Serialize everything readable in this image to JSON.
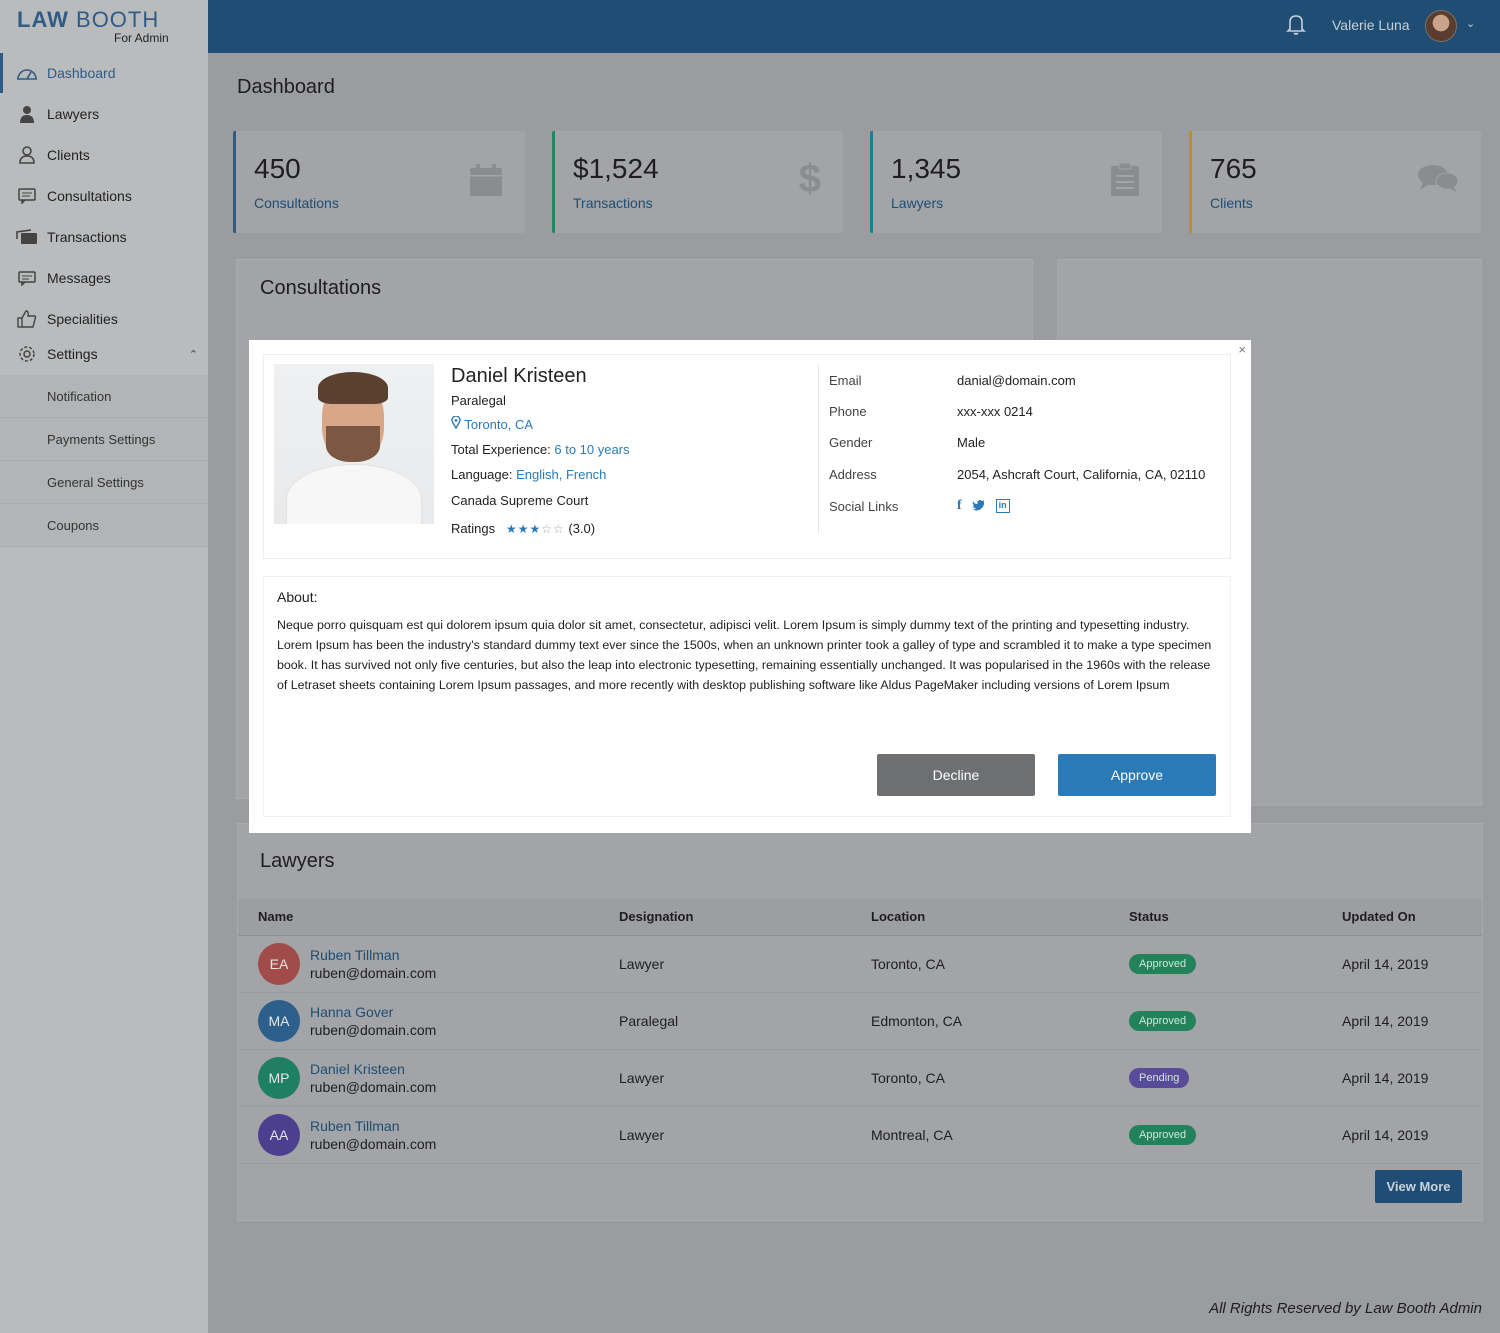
{
  "brand": {
    "name_bold": "LAW",
    "name_light": "BOOTH",
    "subtitle": "For Admin"
  },
  "sidebar": {
    "items": [
      {
        "label": "Dashboard",
        "icon": "dashboard-gauge-icon",
        "active": true
      },
      {
        "label": "Lawyers",
        "icon": "lawyer-icon"
      },
      {
        "label": "Clients",
        "icon": "clients-icon"
      },
      {
        "label": "Consultations",
        "icon": "consultations-icon"
      },
      {
        "label": "Transactions",
        "icon": "transactions-icon"
      },
      {
        "label": "Messages",
        "icon": "messages-icon"
      },
      {
        "label": "Specialities",
        "icon": "thumbs-up-icon"
      },
      {
        "label": "Settings",
        "icon": "gear-icon",
        "expanded": true
      }
    ],
    "settings_sub": [
      "Notification",
      "Payments Settings",
      "General Settings",
      "Coupons"
    ]
  },
  "header": {
    "user_name": "Valerie Luna"
  },
  "page_title": "Dashboard",
  "stats": [
    {
      "value": "450",
      "label": "Consultations",
      "icon": "calendar-icon",
      "color": "#2f5c86"
    },
    {
      "value": "$1,524",
      "label": "Transactions",
      "icon": "dollar-icon",
      "color": "#1f8a5f"
    },
    {
      "value": "1,345",
      "label": "Lawyers",
      "icon": "clipboard-icon",
      "color": "#1e7f94"
    },
    {
      "value": "765",
      "label": "Clients",
      "icon": "comments-icon",
      "color": "#b59418"
    }
  ],
  "consultations_card": {
    "title": "Consultations"
  },
  "lawyers_card": {
    "title": "Lawyers",
    "columns": [
      "Name",
      "Designation",
      "Location",
      "Status",
      "Updated On"
    ],
    "rows": [
      {
        "initials": "EA",
        "avatar_color": "#a24b4b",
        "name": "Ruben Tillman",
        "email": "ruben@domain.com",
        "designation": "Lawyer",
        "location": "Toronto, CA",
        "status": "Approved",
        "status_color": "#22825a",
        "updated": "April 14, 2019"
      },
      {
        "initials": "MA",
        "avatar_color": "#2c5f8c",
        "name": "Hanna Gover",
        "email": "ruben@domain.com",
        "designation": "Paralegal",
        "location": "Edmonton, CA",
        "status": "Approved",
        "status_color": "#22825a",
        "updated": "April 14, 2019"
      },
      {
        "initials": "MP",
        "avatar_color": "#1e7f63",
        "name": "Daniel Kristeen",
        "email": "ruben@domain.com",
        "designation": "Lawyer",
        "location": "Toronto, CA",
        "status": "Pending",
        "status_color": "#5a4a9a",
        "updated": "April 14, 2019"
      },
      {
        "initials": "AA",
        "avatar_color": "#4d3f8f",
        "name": "Ruben Tillman",
        "email": "ruben@domain.com",
        "designation": "Lawyer",
        "location": "Montreal, CA",
        "status": "Approved",
        "status_color": "#22825a",
        "updated": "April 14, 2019"
      }
    ],
    "view_more": "View More"
  },
  "footer": "All Rights Reserved by Law Booth Admin",
  "modal": {
    "close": "×",
    "name": "Daniel Kristeen",
    "designation": "Paralegal",
    "location": "Toronto, CA",
    "experience_label": "Total Experience:",
    "experience_value": "6 to 10 years",
    "language_label": "Language:",
    "language_value": "English, French",
    "court": "Canada Supreme Court",
    "ratings_label": "Ratings",
    "rating_value": 3,
    "rating_text": "(3.0)",
    "info": [
      {
        "key": "Email",
        "value": "danial@domain.com"
      },
      {
        "key": "Phone",
        "value": "xxx-xxx 0214"
      },
      {
        "key": "Gender",
        "value": "Male"
      },
      {
        "key": "Address",
        "value": "2054, Ashcraft Court, California, CA,  02110"
      },
      {
        "key": "Social Links",
        "value": ""
      }
    ],
    "about_title": "About:",
    "about_text": "Neque porro quisquam est qui dolorem ipsum quia dolor sit amet, consectetur, adipisci velit. Lorem Ipsum is simply dummy text of the printing and typesetting industry. Lorem Ipsum has been the industry's standard dummy text ever since the 1500s, when an unknown printer took a galley of type and scrambled it to make a type specimen book. It has survived not only five centuries, but also the leap into electronic typesetting, remaining essentially unchanged. It was popularised in the 1960s with the release of Letraset sheets containing Lorem Ipsum passages, and more recently with desktop publishing software like Aldus PageMaker including versions of Lorem Ipsum",
    "decline": "Decline",
    "approve": "Approve"
  }
}
